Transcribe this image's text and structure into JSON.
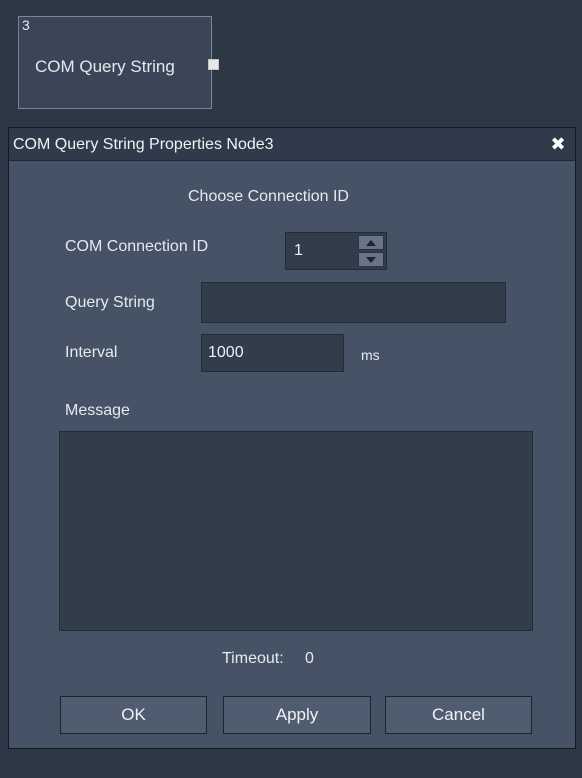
{
  "node": {
    "number": "3",
    "label": "COM Query String"
  },
  "dialog": {
    "title": "COM Query String Properties Node3",
    "close_glyph": "✖",
    "heading": "Choose Connection ID",
    "connection_id": {
      "label": "COM Connection ID",
      "value": "1"
    },
    "query_string": {
      "label": "Query String",
      "value": ""
    },
    "interval": {
      "label": "Interval",
      "value": "1000",
      "unit": "ms"
    },
    "message": {
      "label": "Message",
      "value": ""
    },
    "timeout": {
      "label": "Timeout:",
      "value": "0"
    },
    "buttons": {
      "ok": "OK",
      "apply": "Apply",
      "cancel": "Cancel"
    }
  },
  "icons": {
    "close": "close-icon",
    "spin_up": "spin-up-icon",
    "spin_down": "spin-down-icon",
    "output_port": "output-port"
  },
  "colors": {
    "background": "#2d3847",
    "dialog": "#465366",
    "titlebar": "#2f3a4a",
    "field": "#323d4c",
    "button": "#505d71",
    "text": "#e6e9ee"
  }
}
